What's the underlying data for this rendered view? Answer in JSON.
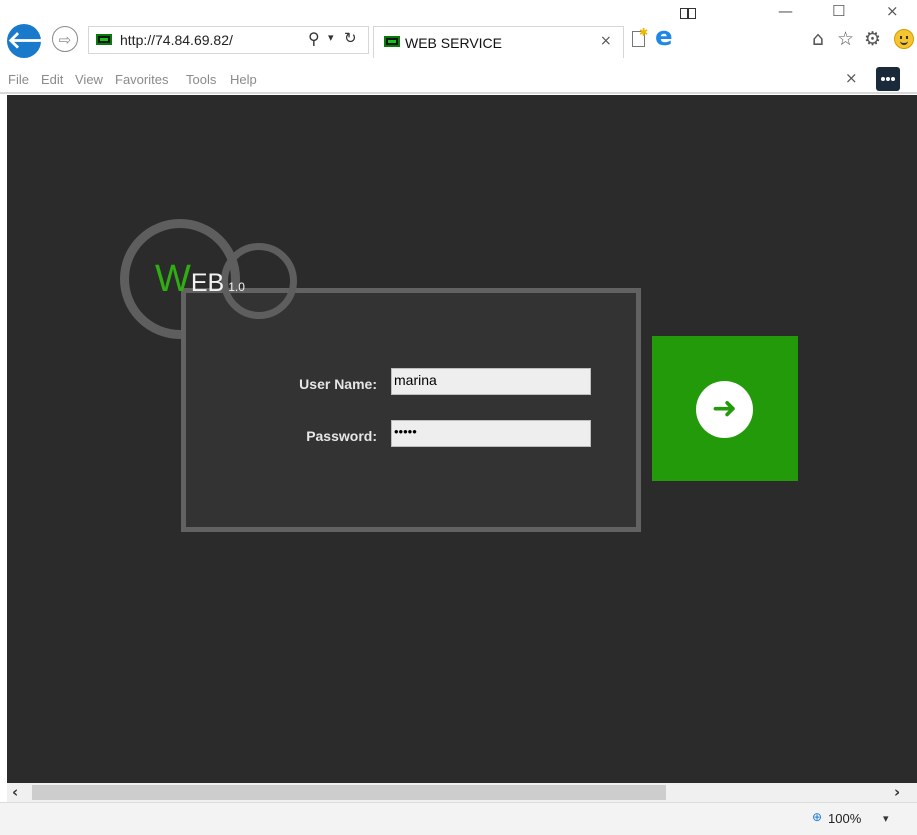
{
  "browser": {
    "url": "http://74.84.69.82/",
    "tab_title": "WEB SERVICE",
    "tab_close": "×",
    "nav_back": "🡐",
    "nav_forward": "⇨",
    "search_glyph": "⚲",
    "dropdown_glyph": "▾",
    "refresh_glyph": "↻",
    "window_minimize": "—",
    "window_maximize": "☐",
    "window_close": "×",
    "home_glyph": "⌂",
    "favorites_glyph": "☆",
    "settings_glyph": "⚙",
    "accent_color": "#1979ca"
  },
  "menu": {
    "items": [
      "File",
      "Edit",
      "View",
      "Favorites",
      "Tools",
      "Help"
    ],
    "close_glyph": "×"
  },
  "page": {
    "background_color": "#2b2b2b",
    "logo": {
      "letter": "W",
      "rest": "EB",
      "version": "1.0",
      "color": "#2eae12"
    },
    "username_label": "User Name:",
    "username_value": "marina",
    "password_label": "Password:",
    "password_value": "•••••",
    "login_button_color": "#229a09",
    "login_icon": "➜"
  },
  "scrollbar": {
    "left_glyph": "‹",
    "right_glyph": "›"
  },
  "status": {
    "zoom": "100%",
    "zoom_glyph": "⊕",
    "dropdown_glyph": "▾"
  }
}
